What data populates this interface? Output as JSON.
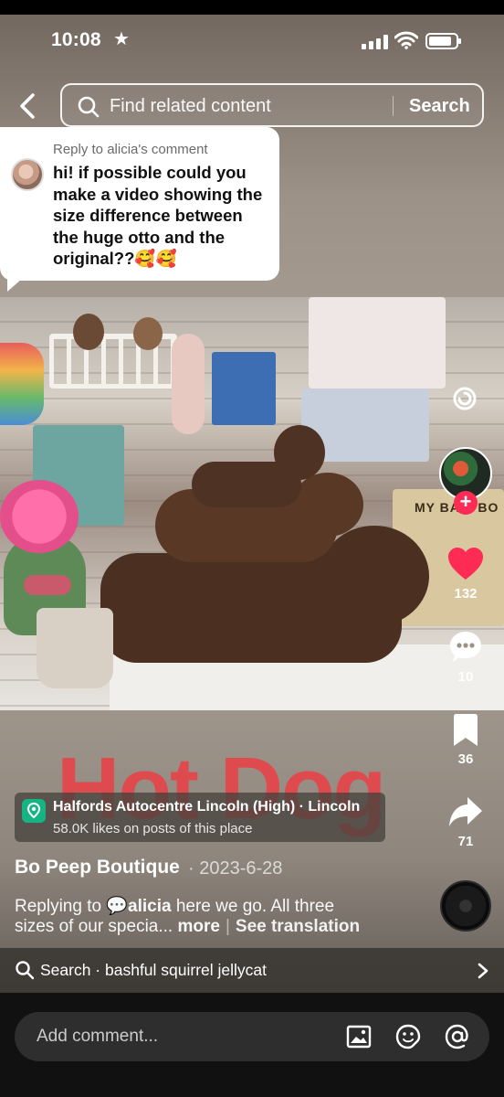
{
  "status": {
    "time": "10:08"
  },
  "search": {
    "placeholder": "Find related content",
    "button": "Search"
  },
  "reply": {
    "label": "Reply to alicia's comment",
    "text": "hi! if possible could you make a video showing the size difference between the huge otto and the original??🥰🥰"
  },
  "video": {
    "book_title": "MY BA... BO"
  },
  "actions": {
    "likes": "132",
    "comments": "10",
    "saves": "36",
    "shares": "71"
  },
  "overlay": {
    "caption": "Hot Dog"
  },
  "location": {
    "name": "Halfords Autocentre Lincoln (High) · Lincoln",
    "likes": "58.0K likes on posts of this place"
  },
  "post": {
    "author": "Bo Peep Boutique",
    "date": "· 2023-6-28",
    "desc_prefix": "Replying to ",
    "mention": "alicia",
    "desc_suffix": " here we go. All three",
    "desc_line2": "sizes of our specia...",
    "more": "more",
    "see_translation": "See translation"
  },
  "related": {
    "text": "Search · bashful squirrel jellycat"
  },
  "comment": {
    "placeholder": "Add comment..."
  },
  "colors": {
    "like": "#fe2c55",
    "location_pin": "#15b482",
    "caption": "#e5454a"
  }
}
